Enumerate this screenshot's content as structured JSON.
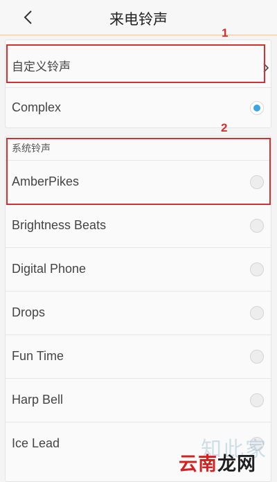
{
  "header": {
    "title": "来电铃声",
    "back_icon": "chevron-left-icon"
  },
  "custom": {
    "label": "自定义铃声",
    "chevron_icon": "chevron-right-icon"
  },
  "complex": {
    "label": "Complex",
    "selected": true
  },
  "system": {
    "section_label": "系统铃声",
    "items": [
      {
        "label": "AmberPikes",
        "selected": false
      },
      {
        "label": "Brightness Beats",
        "selected": false
      },
      {
        "label": "Digital Phone",
        "selected": false
      },
      {
        "label": "Drops",
        "selected": false
      },
      {
        "label": "Fun Time",
        "selected": false
      },
      {
        "label": "Harp Bell",
        "selected": false
      },
      {
        "label": "Ice Lead",
        "selected": false
      }
    ]
  },
  "annotations": {
    "one": "1",
    "two": "2"
  },
  "watermark": {
    "top": "知此家",
    "bottom_left": "云南",
    "bottom_right": "龙网"
  },
  "colors": {
    "accent": "#3aa6e6",
    "annotation": "#d62f2f"
  }
}
